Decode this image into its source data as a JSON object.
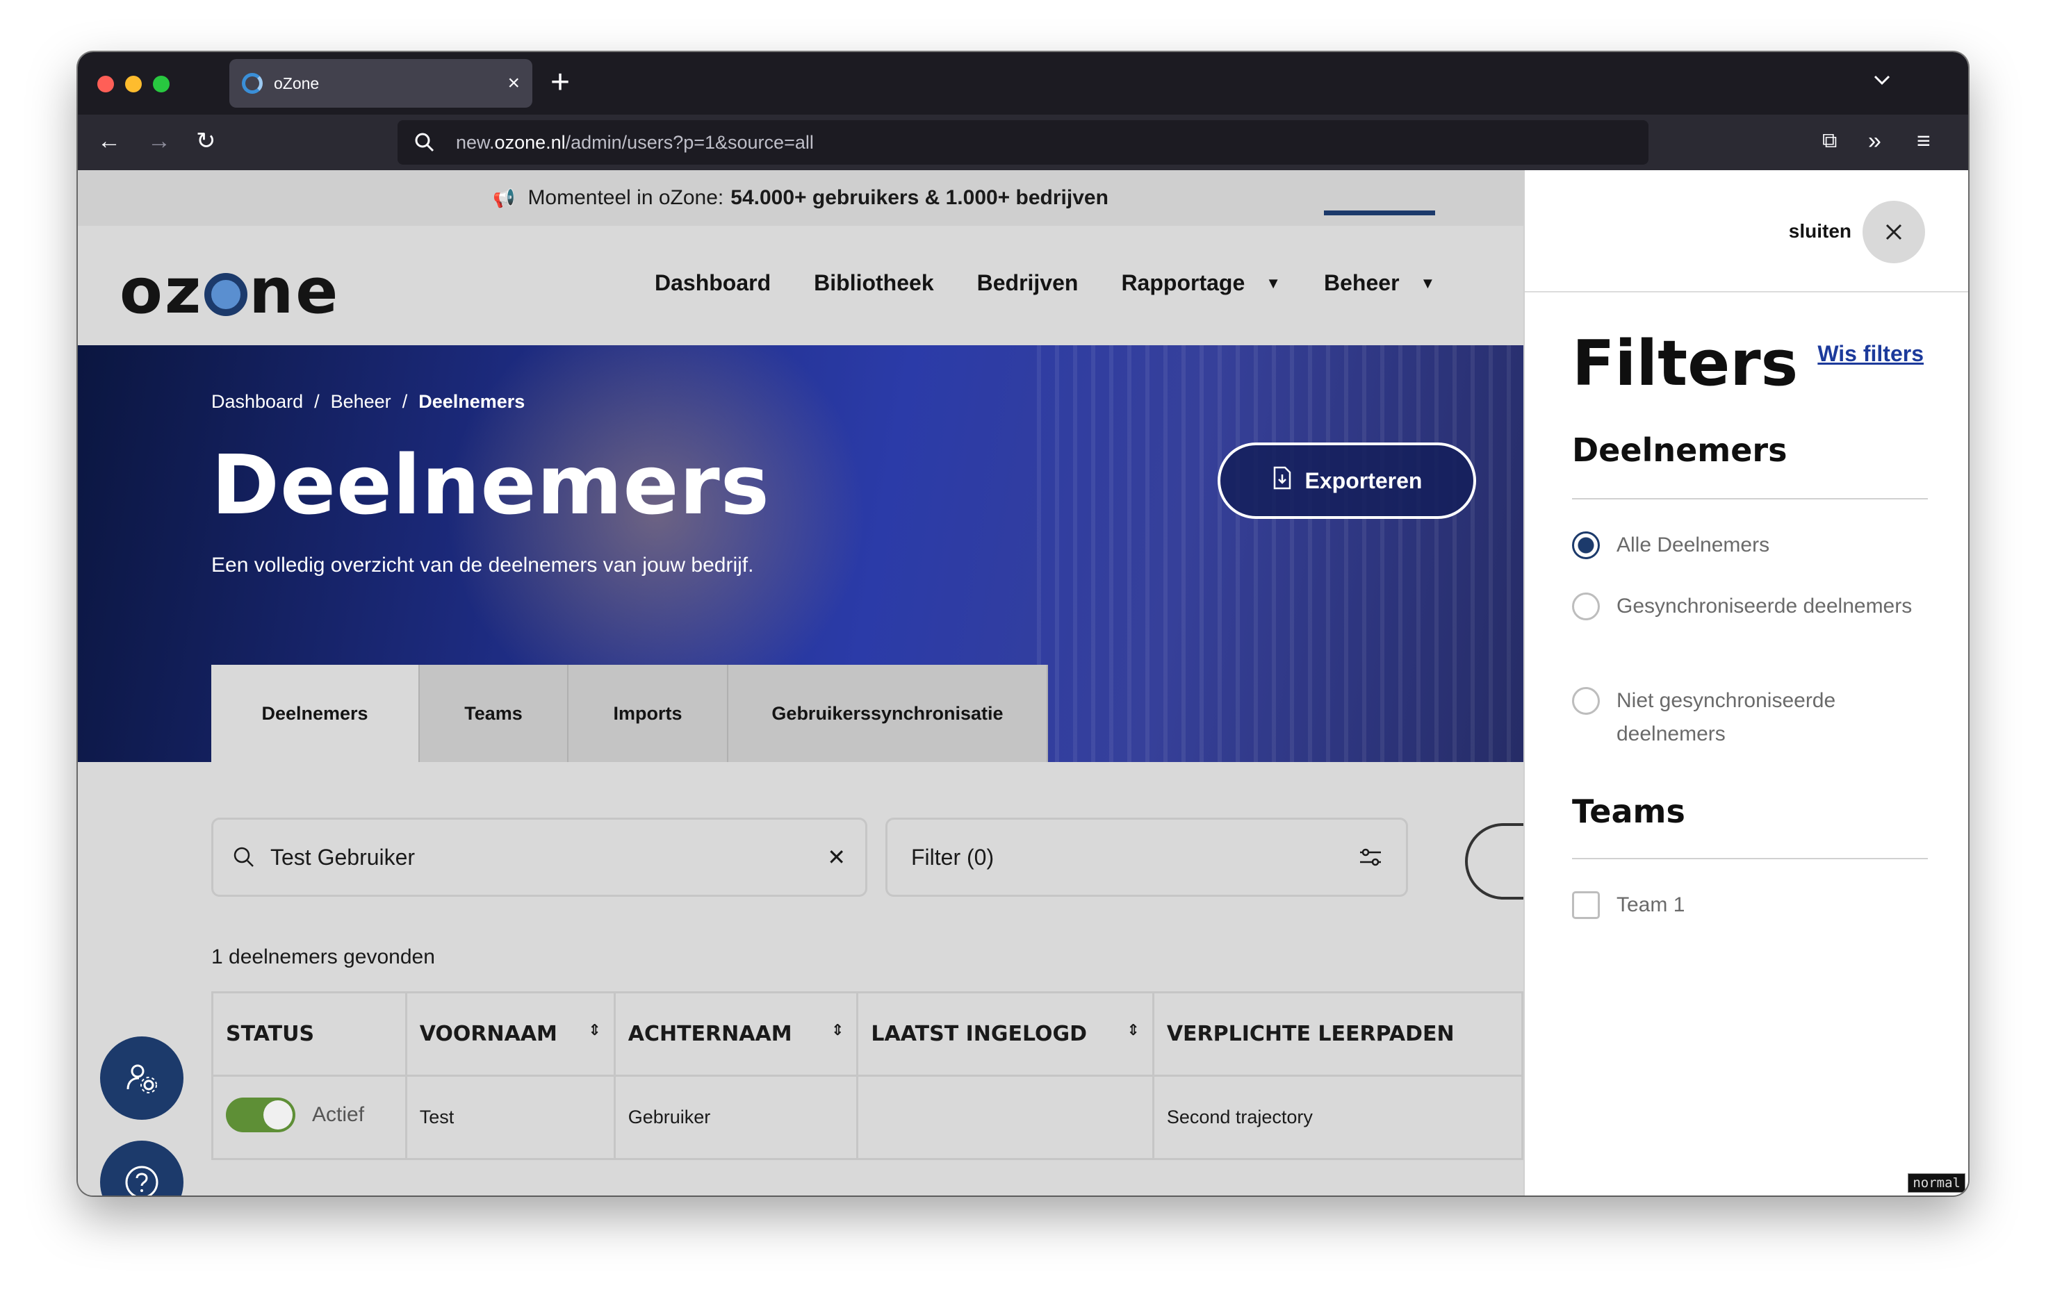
{
  "browser": {
    "tab_title": "oZone",
    "url_prefix": "new.",
    "url_domain": "ozone.nl",
    "url_path": "/admin/users?p=1&source=all"
  },
  "announcement": {
    "prefix": "Momenteel in oZone:",
    "highlight": "54.000+ gebruikers & 1.000+ bedrijven"
  },
  "logo": {
    "left": "oz",
    "right": "ne"
  },
  "nav": {
    "items": [
      {
        "label": "Dashboard"
      },
      {
        "label": "Bibliotheek"
      },
      {
        "label": "Bedrijven"
      },
      {
        "label": "Rapportage"
      },
      {
        "label": "Beheer"
      }
    ]
  },
  "breadcrumb": {
    "home": "Dashboard",
    "parent": "Beheer",
    "current": "Deelnemers",
    "separator": "/"
  },
  "hero": {
    "title": "Deelnemers",
    "subtitle": "Een volledig overzicht van de deelnemers van jouw bedrijf.",
    "export_label": "Exporteren"
  },
  "tabs": [
    {
      "label": "Deelnemers"
    },
    {
      "label": "Teams"
    },
    {
      "label": "Imports"
    },
    {
      "label": "Gebruikerssynchronisatie"
    }
  ],
  "search": {
    "value": "Test Gebruiker"
  },
  "filter_button": {
    "label": "Filter (0)"
  },
  "results": {
    "count_text": "1 deelnemers gevonden"
  },
  "table": {
    "headers": [
      "STATUS",
      "VOORNAAM",
      "ACHTERNAAM",
      "LAATST INGELOGD",
      "VERPLICHTE LEERPADEN"
    ],
    "rows": [
      {
        "status": "Actief",
        "firstname": "Test",
        "lastname": "Gebruiker",
        "last_login": "",
        "paths": "Second trajectory"
      }
    ]
  },
  "filters": {
    "close_label": "sluiten",
    "title": "Filters",
    "clear_label": "Wis filters",
    "participants_heading": "Deelnemers",
    "participant_options": [
      {
        "label": "Alle Deelnemers"
      },
      {
        "label": "Gesynchroniseerde deelnemers"
      },
      {
        "label": "Niet gesynchroniseerde deelnemers"
      }
    ],
    "teams_heading": "Teams",
    "team_options": [
      {
        "label": "Team 1"
      }
    ]
  },
  "debug_badge": "normal",
  "colors": {
    "brand": "#1c3a6b",
    "toggle_on": "#5e8f36",
    "link": "#1c3a9b"
  }
}
